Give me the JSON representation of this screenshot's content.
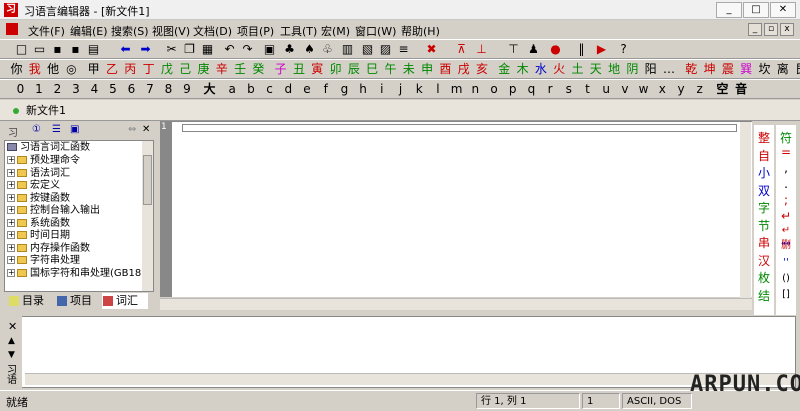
{
  "window": {
    "title": "习语言编辑器 - [新文件1]",
    "app_icon": "习"
  },
  "window_controls": {
    "minimize": "_",
    "maximize": "□",
    "close": "✕"
  },
  "mdi_controls": {
    "minimize": "_",
    "restore": "▫",
    "close": "x"
  },
  "menu": [
    "文件(F)",
    "编辑(E)",
    "搜索(S)",
    "视图(V)",
    "文档(D)",
    "项目(P)",
    "工具(T)",
    "宏(M)",
    "窗口(W)",
    "帮助(H)"
  ],
  "toolbar_icons": [
    "new-file",
    "open-file",
    "save",
    "save-all",
    "print",
    "back",
    "forward",
    "cut",
    "copy",
    "paste",
    "undo",
    "redo",
    "find",
    "find-next",
    "replace",
    "find-in-files",
    "go-to",
    "bookmark",
    "outline",
    "indent",
    "delete",
    "compile",
    "build",
    "run-build",
    "debug",
    "breakpoint",
    "pause",
    "play",
    "help"
  ],
  "char_row1": [
    "你",
    "我",
    "他",
    "◎",
    "甲",
    "乙",
    "丙",
    "丁",
    "戊",
    "己",
    "庚",
    "辛",
    "壬",
    "癸",
    "子",
    "丑",
    "寅",
    "卯",
    "辰",
    "巳",
    "午",
    "未",
    "申",
    "酉",
    "戌",
    "亥",
    "金",
    "木",
    "水",
    "火",
    "土",
    "天",
    "地",
    "阴",
    "阳",
    "…",
    "乾",
    "坤",
    "震",
    "巽",
    "坎",
    "离",
    "艮"
  ],
  "char_row1_colors": [
    "#000",
    "#c00",
    "#000",
    "#000",
    "#000",
    "#c00",
    "#c00",
    "#c00",
    "#080",
    "#080",
    "#080",
    "#c00",
    "#080",
    "#080",
    "#c0c",
    "#080",
    "#c00",
    "#080",
    "#080",
    "#080",
    "#080",
    "#080",
    "#080",
    "#c00",
    "#c00",
    "#c00",
    "#080",
    "#080",
    "#00c",
    "#c00",
    "#080",
    "#080",
    "#080",
    "#080",
    "#000",
    "#000",
    "#c00",
    "#c00",
    "#c00",
    "#c0c",
    "#000",
    "#000",
    "#000"
  ],
  "char_row2": [
    "0",
    "1",
    "2",
    "3",
    "4",
    "5",
    "6",
    "7",
    "8",
    "9",
    "大",
    "a",
    "b",
    "c",
    "d",
    "e",
    "f",
    "g",
    "h",
    "i",
    "j",
    "k",
    "l",
    "m",
    "n",
    "o",
    "p",
    "q",
    "r",
    "s",
    "t",
    "u",
    "v",
    "w",
    "x",
    "y",
    "z",
    "空",
    "音"
  ],
  "doc_tab": {
    "label": "新文件1"
  },
  "left_panel": {
    "header_labels": [
      "习",
      "①",
      "☰",
      "▣",
      "⇔",
      "✕"
    ],
    "tree_root": "习语言词汇函数",
    "tree_items": [
      "预处理命令",
      "语法词汇",
      "宏定义",
      "按键函数",
      "控制台输入输出",
      "系统函数",
      "时间日期",
      "内存操作函数",
      "字符串处理",
      "国标字符和串处理(GB18"
    ],
    "tabs": [
      "目录",
      "项目",
      "词汇"
    ]
  },
  "editor": {
    "line_number": "1"
  },
  "right_panel1": [
    {
      "t": "整",
      "c": "#c00"
    },
    {
      "t": "自",
      "c": "#c00"
    },
    {
      "t": "小",
      "c": "#00c"
    },
    {
      "t": "双",
      "c": "#00c"
    },
    {
      "t": "字",
      "c": "#080"
    },
    {
      "t": "节",
      "c": "#080"
    },
    {
      "t": "串",
      "c": "#c00"
    },
    {
      "t": "汉",
      "c": "#c00"
    },
    {
      "t": "枚",
      "c": "#080"
    },
    {
      "t": "结",
      "c": "#080"
    }
  ],
  "right_panel2": [
    {
      "t": "符",
      "c": "#080"
    },
    {
      "t": "=",
      "c": "#c00"
    },
    {
      "t": ",",
      "c": "#000"
    },
    {
      "t": ".",
      "c": "#000"
    },
    {
      "t": ";",
      "c": "#c00"
    },
    {
      "t": "↵",
      "c": "#c00"
    },
    {
      "t": "↵删",
      "c": "#c00"
    },
    {
      "t": "\"\"",
      "c": "#00c"
    },
    {
      "t": "''",
      "c": "#00c"
    },
    {
      "t": "()",
      "c": "#000"
    },
    {
      "t": "[]",
      "c": "#000"
    }
  ],
  "output_panel": {
    "side_label": "习语",
    "controls": [
      "✕",
      "▲",
      "▼"
    ]
  },
  "status": {
    "ready": "就绪",
    "position": "行 1, 列 1",
    "col": "1",
    "encoding": "ASCII, DOS"
  },
  "watermark": "ARPUN.COM"
}
